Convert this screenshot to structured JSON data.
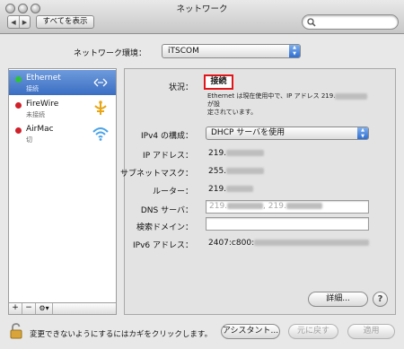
{
  "window": {
    "title": "ネットワーク",
    "show_all_label": "すべてを表示",
    "back_icon": "chevron-left-icon",
    "forward_icon": "chevron-right-icon"
  },
  "search": {
    "placeholder": ""
  },
  "location": {
    "label": "ネットワーク環境：",
    "value": "iTSCOM"
  },
  "services": [
    {
      "name": "Ethernet",
      "status": "接続",
      "icon": "ethernet-icon",
      "dot_color": "#2ec23a"
    },
    {
      "name": "FireWire",
      "status": "未接続",
      "icon": "firewire-icon",
      "dot_color": "#d0202a"
    },
    {
      "name": "AirMac",
      "status": "切",
      "icon": "wifi-icon",
      "dot_color": "#d0202a"
    }
  ],
  "sidebar_controls": {
    "add": "+",
    "remove": "−",
    "gear": "⚙▾"
  },
  "detail": {
    "status_label": "状況：",
    "status_value": "接続",
    "status_desc_1": "Ethernet は現在使用中で、IP アドレス 219.",
    "status_desc_2": "が設",
    "status_desc_3": "定されています。",
    "ipv4_label": "IPv4 の構成：",
    "ipv4_value": "DHCP サーバを使用",
    "ip_label": "IP アドレス：",
    "ip_value": "219.",
    "subnet_label": "サブネットマスク：",
    "subnet_value": "255.",
    "router_label": "ルーター：",
    "router_value": "219.",
    "dns_label": "DNS サーバ：",
    "dns_value_1": "219.",
    "dns_value_2": ", 219.",
    "search_domain_label": "検索ドメイン：",
    "ipv6_label": "IPv6 アドレス：",
    "ipv6_value": "2407:c800:",
    "advanced_button": "詳細...",
    "help_button": "?"
  },
  "footer": {
    "lock_text": "変更できないようにするにはカギをクリックします。",
    "assistant_button": "アシスタント...",
    "revert_button": "元に戻す",
    "apply_button": "適用"
  }
}
